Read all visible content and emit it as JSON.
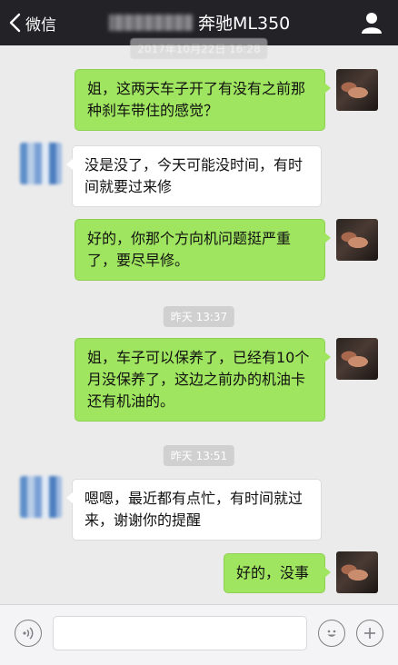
{
  "header": {
    "back_label": "微信",
    "chat_title": "奔驰ML350"
  },
  "messages": [
    {
      "from": "me",
      "text": "姐，这两天车子开了有没有之前那种刹车带住的感觉？"
    },
    {
      "from": "other",
      "text": "没是没了，今天可能没时间，有时间就要过来修"
    },
    {
      "from": "me",
      "text": "好的，你那个方向机问题挺严重了，要尽早修。"
    },
    {
      "from": "me",
      "text": "姐，车子可以保养了，已经有10个月没保养了，这边之前办的机油卡还有机油的。"
    },
    {
      "from": "other",
      "text": "嗯嗯，最近都有点忙，有时间就过来，谢谢你的提醒"
    },
    {
      "from": "me",
      "text": "好的，没事"
    }
  ],
  "timestamps": {
    "ts0": "2017年10月22日 16:28",
    "ts1": "昨天 13:37",
    "ts2": "昨天 13:51"
  },
  "icons": {
    "back": "chevron-left-icon",
    "profile": "user-icon",
    "voice": "voice-icon",
    "emoji": "smile-icon",
    "more": "plus-icon"
  },
  "colors": {
    "nav_bg": "#232327",
    "chat_bg": "#ebebeb",
    "my_bubble": "#9fe55f",
    "other_bubble": "#ffffff"
  }
}
